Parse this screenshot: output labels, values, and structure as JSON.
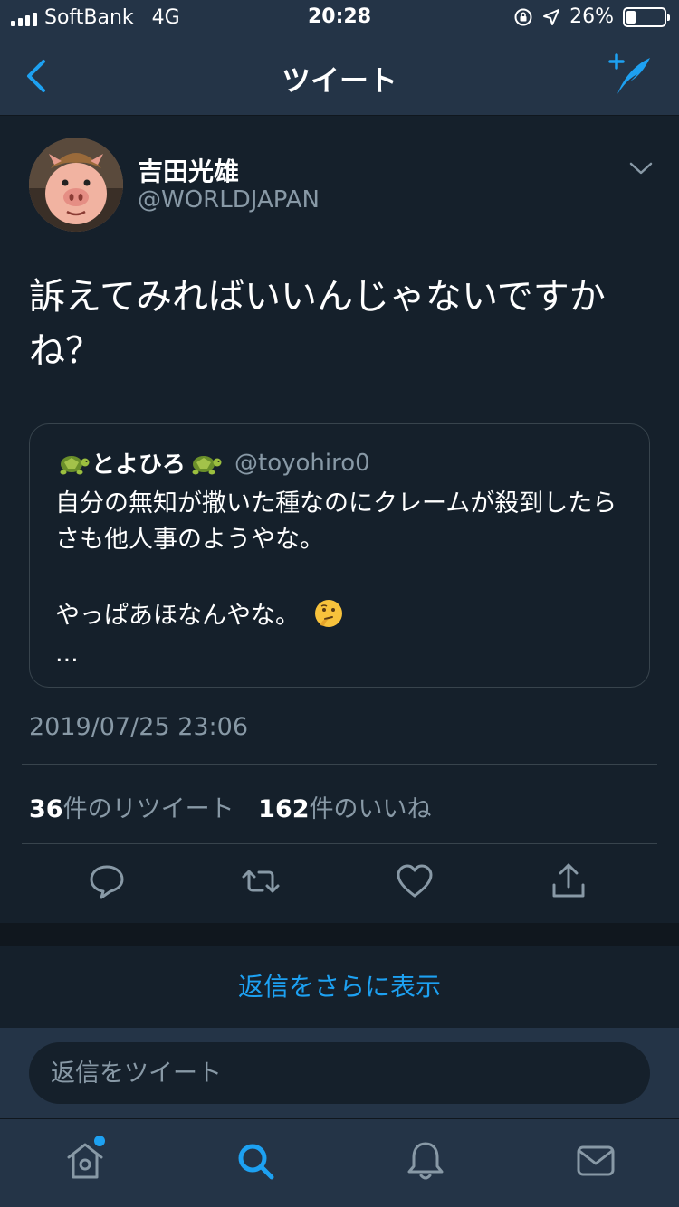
{
  "status_bar": {
    "carrier": "SoftBank",
    "network": "4G",
    "time": "20:28",
    "battery_percent": "26%",
    "battery_level": 0.26
  },
  "nav": {
    "title": "ツイート",
    "back_icon": "chevron-left-icon",
    "compose_icon": "compose-tweet-icon"
  },
  "tweet": {
    "author_name": "吉田光雄",
    "author_handle": "@WORLDJAPAN",
    "text": "訴えてみればいいんじゃないですかね？",
    "quote": {
      "name": "とよひろ",
      "handle": "@toyohiro0",
      "line1": "自分の無知が撒いた種なのにクレームが殺到したらさも他人事のようやな。",
      "line2": "やっぱあほなんやな。",
      "ellipsis": "..."
    },
    "timestamp": "2019/07/25 23:06",
    "retweet_count": "36",
    "retweet_label": "件のリツイート",
    "like_count": "162",
    "like_label": "件のいいね"
  },
  "more_replies": "返信をさらに表示",
  "reply": {
    "placeholder": "返信をツイート"
  },
  "colors": {
    "background": "#15202b",
    "bar": "#243447",
    "accent": "#1da1f2",
    "muted": "#8899a6"
  }
}
